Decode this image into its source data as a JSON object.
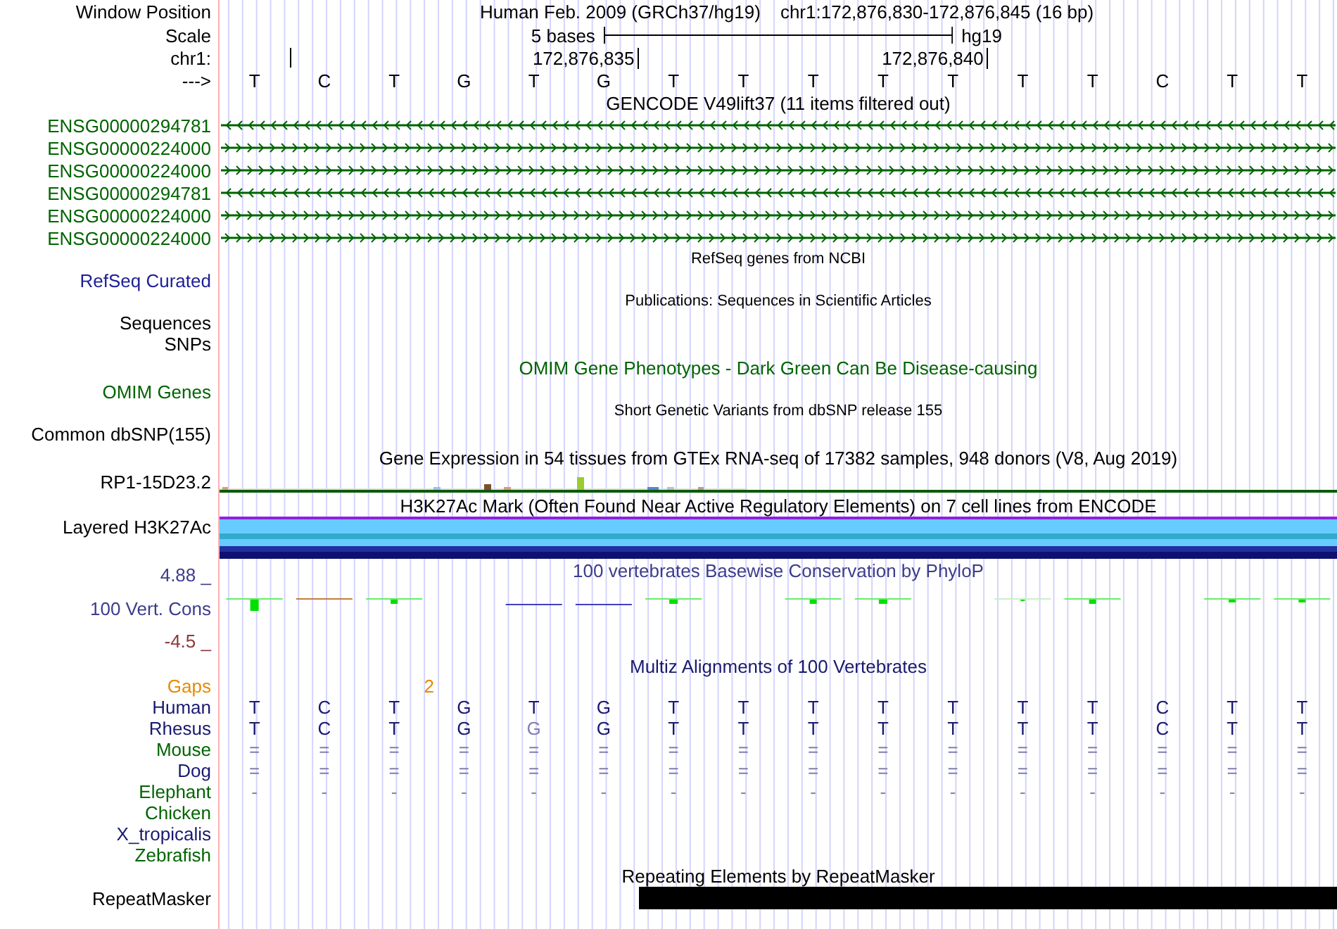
{
  "header": {
    "position_label": "Window Position",
    "assembly": "Human Feb. 2009 (GRCh37/hg19)",
    "position": "chr1:172,876,830-172,876,845 (16 bp)",
    "scale_label": "Scale",
    "scale_text": "5 bases",
    "scale_db": "hg19",
    "chrom_label": "chr1:",
    "ticks": [
      "172,876,835",
      "172,876,840"
    ],
    "strand_label": "--->",
    "bases": [
      "T",
      "C",
      "T",
      "G",
      "T",
      "G",
      "T",
      "T",
      "T",
      "T",
      "T",
      "T",
      "T",
      "C",
      "T",
      "T"
    ]
  },
  "gencode": {
    "title": "GENCODE V49lift37 (11 items filtered out)",
    "genes": [
      {
        "name": "ENSG00000294781",
        "reverse": true
      },
      {
        "name": "ENSG00000224000",
        "reverse": false
      },
      {
        "name": "ENSG00000224000",
        "reverse": false
      },
      {
        "name": "ENSG00000294781",
        "reverse": true
      },
      {
        "name": "ENSG00000224000",
        "reverse": false
      },
      {
        "name": "ENSG00000224000",
        "reverse": false
      }
    ]
  },
  "refseq": {
    "title": "RefSeq genes from NCBI",
    "label": "RefSeq Curated"
  },
  "publications": {
    "title": "Publications: Sequences in Scientific Articles",
    "labels": [
      "Sequences",
      "SNPs"
    ]
  },
  "omim": {
    "title": "OMIM Gene Phenotypes - Dark Green Can Be Disease-causing",
    "label": "OMIM Genes"
  },
  "dbsnp": {
    "title": "Short Genetic Variants from dbSNP release 155",
    "label": "Common dbSNP(155)"
  },
  "gtex": {
    "title": "Gene Expression in 54 tissues from GTEx RNA-seq of 17382 samples, 948 donors (V8, Aug 2019)",
    "label": "RP1-15D23.2"
  },
  "h3k27ac": {
    "title": "H3K27Ac Mark (Often Found Near Active Regulatory Elements) on 7 cell lines from ENCODE",
    "label": "Layered H3K27Ac"
  },
  "phylop": {
    "title": "100 vertebrates Basewise Conservation by PhyloP",
    "label": "100 Vert. Cons",
    "max": "4.88 _",
    "min": "-4.5 _"
  },
  "multiz": {
    "title": "Multiz Alignments of 100 Vertebrates",
    "gaps_label": "Gaps",
    "gaps_value": "2",
    "species": [
      {
        "name": "Human",
        "color": "#191970",
        "bases": [
          {
            "b": "T",
            "dim": false
          },
          {
            "b": "C",
            "dim": false
          },
          {
            "b": "T",
            "dim": false
          },
          {
            "b": "G",
            "dim": false
          },
          {
            "b": "T",
            "dim": false
          },
          {
            "b": "G",
            "dim": false
          },
          {
            "b": "T",
            "dim": false
          },
          {
            "b": "T",
            "dim": false
          },
          {
            "b": "T",
            "dim": false
          },
          {
            "b": "T",
            "dim": false
          },
          {
            "b": "T",
            "dim": false
          },
          {
            "b": "T",
            "dim": false
          },
          {
            "b": "T",
            "dim": false
          },
          {
            "b": "C",
            "dim": false
          },
          {
            "b": "T",
            "dim": false
          },
          {
            "b": "T",
            "dim": false
          }
        ]
      },
      {
        "name": "Rhesus",
        "color": "#191970",
        "bases": [
          {
            "b": "T",
            "dim": false
          },
          {
            "b": "C",
            "dim": false
          },
          {
            "b": "T",
            "dim": false
          },
          {
            "b": "G",
            "dim": false
          },
          {
            "b": "G",
            "dim": true
          },
          {
            "b": "G",
            "dim": false
          },
          {
            "b": "T",
            "dim": false
          },
          {
            "b": "T",
            "dim": false
          },
          {
            "b": "T",
            "dim": false
          },
          {
            "b": "T",
            "dim": false
          },
          {
            "b": "T",
            "dim": false
          },
          {
            "b": "T",
            "dim": false
          },
          {
            "b": "T",
            "dim": false
          },
          {
            "b": "C",
            "dim": false
          },
          {
            "b": "T",
            "dim": false
          },
          {
            "b": "T",
            "dim": false
          }
        ]
      },
      {
        "name": "Mouse",
        "color": "#006400",
        "bases": [
          {
            "b": "=",
            "dim": true
          },
          {
            "b": "=",
            "dim": true
          },
          {
            "b": "=",
            "dim": true
          },
          {
            "b": "=",
            "dim": true
          },
          {
            "b": "=",
            "dim": true
          },
          {
            "b": "=",
            "dim": true
          },
          {
            "b": "=",
            "dim": true
          },
          {
            "b": "=",
            "dim": true
          },
          {
            "b": "=",
            "dim": true
          },
          {
            "b": "=",
            "dim": true
          },
          {
            "b": "=",
            "dim": true
          },
          {
            "b": "=",
            "dim": true
          },
          {
            "b": "=",
            "dim": true
          },
          {
            "b": "=",
            "dim": true
          },
          {
            "b": "=",
            "dim": true
          },
          {
            "b": "=",
            "dim": true
          }
        ]
      },
      {
        "name": "Dog",
        "color": "#191970",
        "bases": [
          {
            "b": "=",
            "dim": true
          },
          {
            "b": "=",
            "dim": true
          },
          {
            "b": "=",
            "dim": true
          },
          {
            "b": "=",
            "dim": true
          },
          {
            "b": "=",
            "dim": true
          },
          {
            "b": "=",
            "dim": true
          },
          {
            "b": "=",
            "dim": true
          },
          {
            "b": "=",
            "dim": true
          },
          {
            "b": "=",
            "dim": true
          },
          {
            "b": "=",
            "dim": true
          },
          {
            "b": "=",
            "dim": true
          },
          {
            "b": "=",
            "dim": true
          },
          {
            "b": "=",
            "dim": true
          },
          {
            "b": "=",
            "dim": true
          },
          {
            "b": "=",
            "dim": true
          },
          {
            "b": "=",
            "dim": true
          }
        ]
      },
      {
        "name": "Elephant",
        "color": "#006400",
        "bases": [
          {
            "b": "-",
            "dim": true
          },
          {
            "b": "-",
            "dim": true
          },
          {
            "b": "-",
            "dim": true
          },
          {
            "b": "-",
            "dim": true
          },
          {
            "b": "-",
            "dim": true
          },
          {
            "b": "-",
            "dim": true
          },
          {
            "b": "-",
            "dim": true
          },
          {
            "b": "-",
            "dim": true
          },
          {
            "b": "-",
            "dim": true
          },
          {
            "b": "-",
            "dim": true
          },
          {
            "b": "-",
            "dim": true
          },
          {
            "b": "-",
            "dim": true
          },
          {
            "b": "-",
            "dim": true
          },
          {
            "b": "-",
            "dim": true
          },
          {
            "b": "-",
            "dim": true
          },
          {
            "b": "-",
            "dim": true
          }
        ]
      },
      {
        "name": "Chicken",
        "color": "#006400"
      },
      {
        "name": "X_tropicalis",
        "color": "#191970"
      },
      {
        "name": "Zebrafish",
        "color": "#006400"
      }
    ]
  },
  "repeatmasker": {
    "title": "Repeating Elements by RepeatMasker",
    "label": "RepeatMasker"
  }
}
